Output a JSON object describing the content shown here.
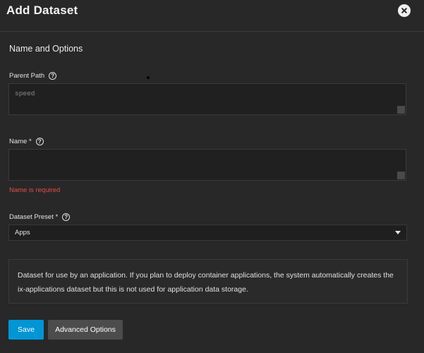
{
  "dialog": {
    "title": "Add Dataset",
    "close_icon": "close-icon"
  },
  "section": {
    "title": "Name and Options"
  },
  "fields": {
    "parent_path": {
      "label": "Parent Path",
      "value": "speed"
    },
    "name": {
      "label": "Name *",
      "value": "",
      "error": "Name is required"
    },
    "dataset_preset": {
      "label": "Dataset Preset *",
      "value": "Apps"
    }
  },
  "description": "Dataset for use by an application. If you plan to deploy container applications, the system automatically creates the ix-applications dataset but this is not used for application data storage.",
  "buttons": {
    "save": "Save",
    "advanced": "Advanced Options"
  },
  "colors": {
    "background": "#282828",
    "primary": "#0095d5",
    "error": "#e44c4c"
  }
}
